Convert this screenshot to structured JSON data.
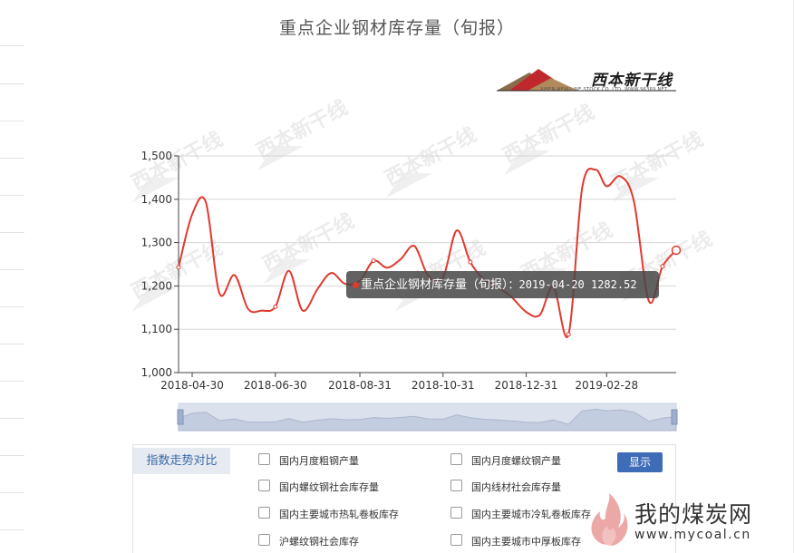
{
  "title": "重点企业钢材库存量（旬报）",
  "logo": {
    "name": "西本新干线",
    "sub": "XIBEN NEW LINE STOCK CO.,LTD.   WWW.96369.NET"
  },
  "chart_data": {
    "type": "line",
    "title": "重点企业钢材库存量（旬报）",
    "xlabel": "",
    "ylabel": "",
    "ylim": [
      1000,
      1500
    ],
    "xlim": [
      "2018-04-20",
      "2019-04-20"
    ],
    "yticks": [
      "1,000",
      "1,100",
      "1,200",
      "1,300",
      "1,400",
      "1,500"
    ],
    "xticks": [
      "2018-04-30",
      "2018-06-30",
      "2018-08-31",
      "2018-10-31",
      "2018-12-31",
      "2019-02-28"
    ],
    "grid": true,
    "color": "#e03a2e",
    "series": [
      {
        "x": [
          "2018-04-20",
          "2018-04-30",
          "2018-05-10",
          "2018-05-20",
          "2018-05-31",
          "2018-06-10",
          "2018-06-20",
          "2018-06-30",
          "2018-07-10",
          "2018-07-20",
          "2018-07-31",
          "2018-08-10",
          "2018-08-20",
          "2018-08-31",
          "2018-09-10",
          "2018-09-20",
          "2018-09-30",
          "2018-10-10",
          "2018-10-20",
          "2018-10-31",
          "2018-11-10",
          "2018-11-20",
          "2018-11-30",
          "2018-12-10",
          "2018-12-20",
          "2018-12-31",
          "2019-01-10",
          "2019-01-20",
          "2019-01-31",
          "2019-02-10",
          "2019-02-20",
          "2019-02-28",
          "2019-03-10",
          "2019-03-20",
          "2019-03-31",
          "2019-04-10",
          "2019-04-20"
        ],
        "values": [
          1243,
          1365,
          1393,
          1183,
          1225,
          1147,
          1143,
          1152,
          1235,
          1143,
          1193,
          1230,
          1205,
          1212,
          1258,
          1242,
          1262,
          1292,
          1224,
          1220,
          1328,
          1255,
          1215,
          1197,
          1175,
          1140,
          1133,
          1198,
          1088,
          1425,
          1468,
          1430,
          1453,
          1395,
          1165,
          1245,
          1282.52
        ]
      }
    ],
    "tooltip": {
      "label": "重点企业钢材库存量（旬报）",
      "value": "：2019-04-20 1282.52"
    }
  },
  "selector": {
    "tab": "指数走势对比",
    "button": "显示",
    "options": [
      "国内月度粗钢产量",
      "国内月度螺纹钢产量",
      "国内螺纹钢社会库存量",
      "国内线材社会库存量",
      "国内主要城市热轧卷板库存",
      "国内主要城市冷轧卷板库存",
      "沪螺纹钢社会库存",
      "国内主要城市中厚板库存"
    ]
  },
  "watermark": {
    "text": "我的煤炭网",
    "url": "www.mycoal.cn"
  }
}
